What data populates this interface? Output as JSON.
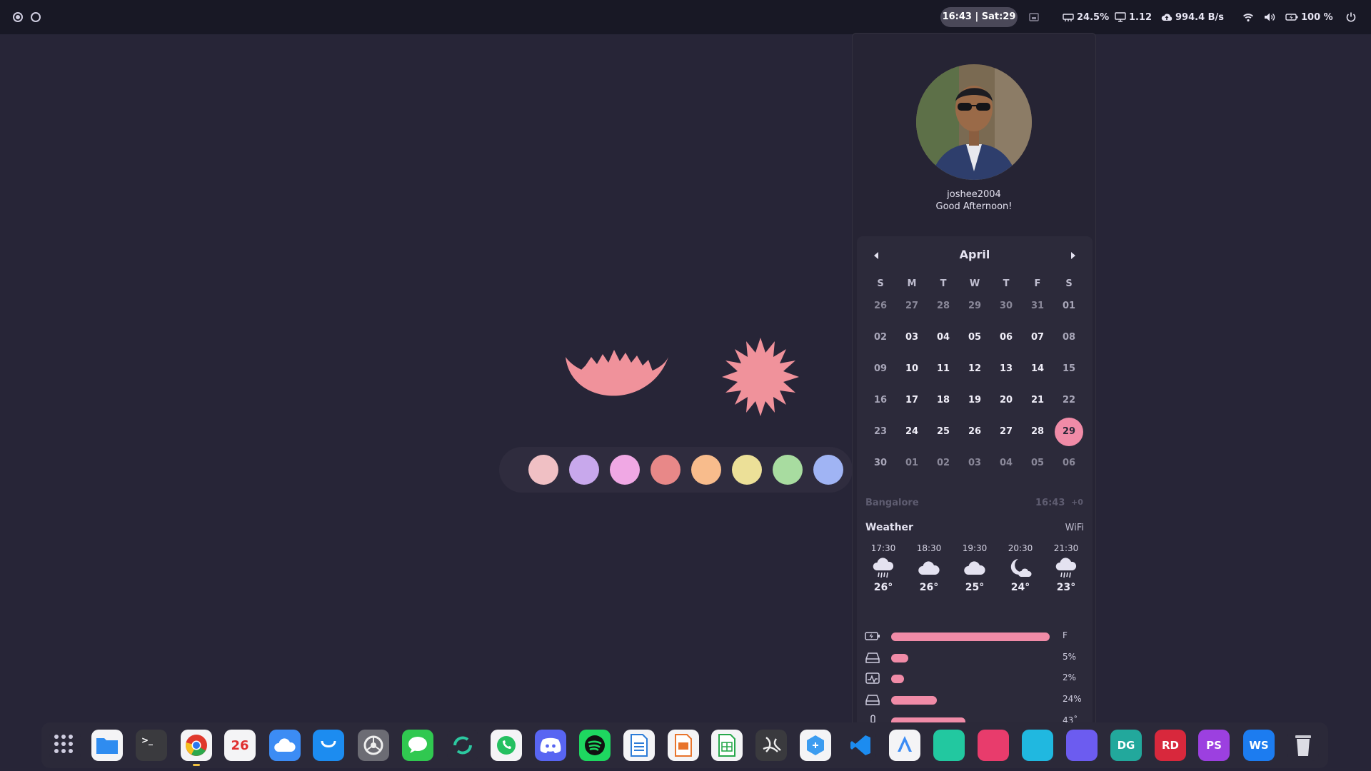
{
  "topbar": {
    "workspaces": [
      "workspace-1",
      "workspace-2"
    ],
    "clock": "16:43 | Sat:29",
    "memory": "24.5%",
    "cpu_load": "1.12",
    "network": "994.4 B/s",
    "battery": "100 %"
  },
  "wallpaper": {
    "palette": [
      "#f0c0c4",
      "#c8a8ec",
      "#f0a8e4",
      "#e88888",
      "#f8bc8c",
      "#ece098",
      "#a8dca0",
      "#a0b4f4"
    ],
    "accent": "#f08ba7"
  },
  "panel": {
    "username": "joshee2004",
    "greeting": "Good Afternoon!",
    "calendar": {
      "month": "April",
      "weekdays": [
        "S",
        "M",
        "T",
        "W",
        "T",
        "F",
        "S"
      ],
      "weeks": [
        [
          "26",
          "27",
          "28",
          "29",
          "30",
          "31",
          "01"
        ],
        [
          "02",
          "03",
          "04",
          "05",
          "06",
          "07",
          "08"
        ],
        [
          "09",
          "10",
          "11",
          "12",
          "13",
          "14",
          "15"
        ],
        [
          "16",
          "17",
          "18",
          "19",
          "20",
          "21",
          "22"
        ],
        [
          "23",
          "24",
          "25",
          "26",
          "27",
          "28",
          "29"
        ],
        [
          "30",
          "01",
          "02",
          "03",
          "04",
          "05",
          "06"
        ]
      ],
      "today": "29"
    },
    "world_clock": {
      "city": "Bangalore",
      "time": "16:43",
      "offset": "+0"
    },
    "weather": {
      "title": "Weather",
      "source": "WiFi",
      "forecast": [
        {
          "time": "17:30",
          "icon": "rain-cloud-icon",
          "temp": "26°"
        },
        {
          "time": "18:30",
          "icon": "cloud-icon",
          "temp": "26°"
        },
        {
          "time": "19:30",
          "icon": "cloud-icon",
          "temp": "25°"
        },
        {
          "time": "20:30",
          "icon": "moon-cloud-icon",
          "temp": "24°"
        },
        {
          "time": "21:30",
          "icon": "rain-cloud-icon",
          "temp": "23°"
        }
      ]
    },
    "stats": [
      {
        "icon": "battery-icon",
        "label": "F",
        "fraction": 1.0
      },
      {
        "icon": "disk-icon",
        "label": "5%",
        "fraction": 0.11
      },
      {
        "icon": "activity-icon",
        "label": "2%",
        "fraction": 0.08
      },
      {
        "icon": "disk-icon",
        "label": "24%",
        "fraction": 0.29
      },
      {
        "icon": "thermometer-icon",
        "label": "43˚",
        "fraction": 0.47
      }
    ]
  },
  "dock": {
    "apps": [
      {
        "name": "app-grid",
        "label": "",
        "color": "#2b2939"
      },
      {
        "name": "files",
        "label": "",
        "color": "#f4f4f6"
      },
      {
        "name": "terminal",
        "label": ">_",
        "color": "#3a3a3e"
      },
      {
        "name": "chrome",
        "label": "",
        "color": "#f4f4f6"
      },
      {
        "name": "calendar",
        "label": "26",
        "color": "#f4f4f6"
      },
      {
        "name": "weather",
        "label": "",
        "color": "#3c8cf4"
      },
      {
        "name": "app-store",
        "label": "",
        "color": "#1c8cf0"
      },
      {
        "name": "settings",
        "label": "",
        "color": "#6c6c74"
      },
      {
        "name": "messages",
        "label": "",
        "color": "#30c850"
      },
      {
        "name": "sync",
        "label": "",
        "color": "#2b2939"
      },
      {
        "name": "whatsapp",
        "label": "",
        "color": "#f4f4f6"
      },
      {
        "name": "discord",
        "label": "",
        "color": "#5865f2"
      },
      {
        "name": "spotify",
        "label": "",
        "color": "#1ed760"
      },
      {
        "name": "writer",
        "label": "",
        "color": "#f4f4f6"
      },
      {
        "name": "impress",
        "label": "",
        "color": "#f4f4f6"
      },
      {
        "name": "calc",
        "label": "",
        "color": "#f4f4f6"
      },
      {
        "name": "obs",
        "label": "",
        "color": "#3a3a3e"
      },
      {
        "name": "pycharm-alt",
        "label": "",
        "color": "#f4f4f6"
      },
      {
        "name": "vscode",
        "label": "",
        "color": "#2b2939"
      },
      {
        "name": "android-studio",
        "label": "",
        "color": "#f4f4f6"
      },
      {
        "name": "jetbrains-1",
        "label": "",
        "color": "#22c8a0"
      },
      {
        "name": "jetbrains-2",
        "label": "",
        "color": "#e83c6c"
      },
      {
        "name": "jetbrains-3",
        "label": "",
        "color": "#20b8e0"
      },
      {
        "name": "jetbrains-4",
        "label": "",
        "color": "#6c5cf0"
      },
      {
        "name": "datagrip",
        "label": "DG",
        "color": "#22a89c"
      },
      {
        "name": "rider",
        "label": "RD",
        "color": "#d8283c"
      },
      {
        "name": "phpstorm",
        "label": "PS",
        "color": "#9c40e0"
      },
      {
        "name": "webstorm",
        "label": "WS",
        "color": "#1c7cf0"
      },
      {
        "name": "trash",
        "label": "",
        "color": "#2b2939"
      }
    ]
  }
}
